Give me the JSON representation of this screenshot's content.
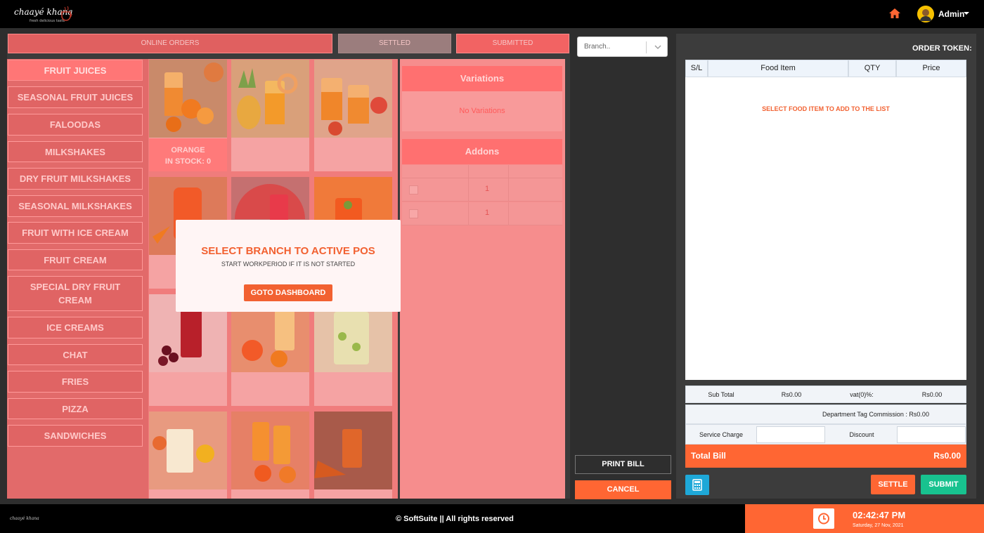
{
  "header": {
    "brand": "chaayé khana",
    "brand_tagline": "fresh delicious taste",
    "user": "Admin"
  },
  "tabs": [
    {
      "label": "ONLINE ORDERS"
    },
    {
      "label": "SETTLED"
    },
    {
      "label": "SUBMITTED"
    }
  ],
  "categories": [
    "FRUIT JUICES",
    "SEASONAL FRUIT JUICES",
    "FALOODAS",
    "MILKSHAKES",
    "DRY FRUIT MILKSHAKES",
    "SEASONAL MILKSHAKES",
    "FRUIT WITH ICE CREAM",
    "FRUIT CREAM",
    "SPECIAL DRY FRUIT CREAM",
    "ICE CREAMS",
    "CHAT",
    "FRIES",
    "PIZZA",
    "SANDWICHES"
  ],
  "items": [
    {
      "name": "ORANGE",
      "stock": "IN STOCK: 0"
    }
  ],
  "variations": {
    "title": "Variations",
    "empty": "No Variations"
  },
  "addons": {
    "title": "Addons",
    "rows": [
      {
        "qty": "1"
      },
      {
        "qty": "1"
      }
    ]
  },
  "modal": {
    "title": "SELECT BRANCH TO ACTIVE POS",
    "subtitle": "START WORKPERIOD IF IT IS NOT STARTED",
    "button": "GOTO DASHBOARD"
  },
  "branch": {
    "placeholder": "Branch.."
  },
  "actions": {
    "print": "PRINT BILL",
    "cancel": "CANCEL"
  },
  "order": {
    "token_label": "ORDER TOKEN:",
    "columns": [
      "S/L",
      "Food Item",
      "QTY",
      "Price"
    ],
    "empty_message": "SELECT FOOD ITEM TO ADD TO THE LIST",
    "sub_total_label": "Sub Total",
    "sub_total": "Rs0.00",
    "vat_label": "vat(0)%:",
    "vat": "Rs0.00",
    "commission": "Department Tag Commission : Rs0.00",
    "service_charge_label": "Service Charge",
    "discount_label": "Discount",
    "total_label": "Total Bill",
    "total": "Rs0.00",
    "settle": "SETTLE",
    "submit": "SUBMIT"
  },
  "footer": {
    "brand": "chaayé khana",
    "copyright": "© SoftSuite || All rights reserved",
    "time": "02:42:47 PM",
    "date": "Saturday, 27 Nov, 2021"
  },
  "colors": {
    "accent": "#ff6633",
    "success": "#18c28f",
    "info": "#1ea8d8"
  }
}
